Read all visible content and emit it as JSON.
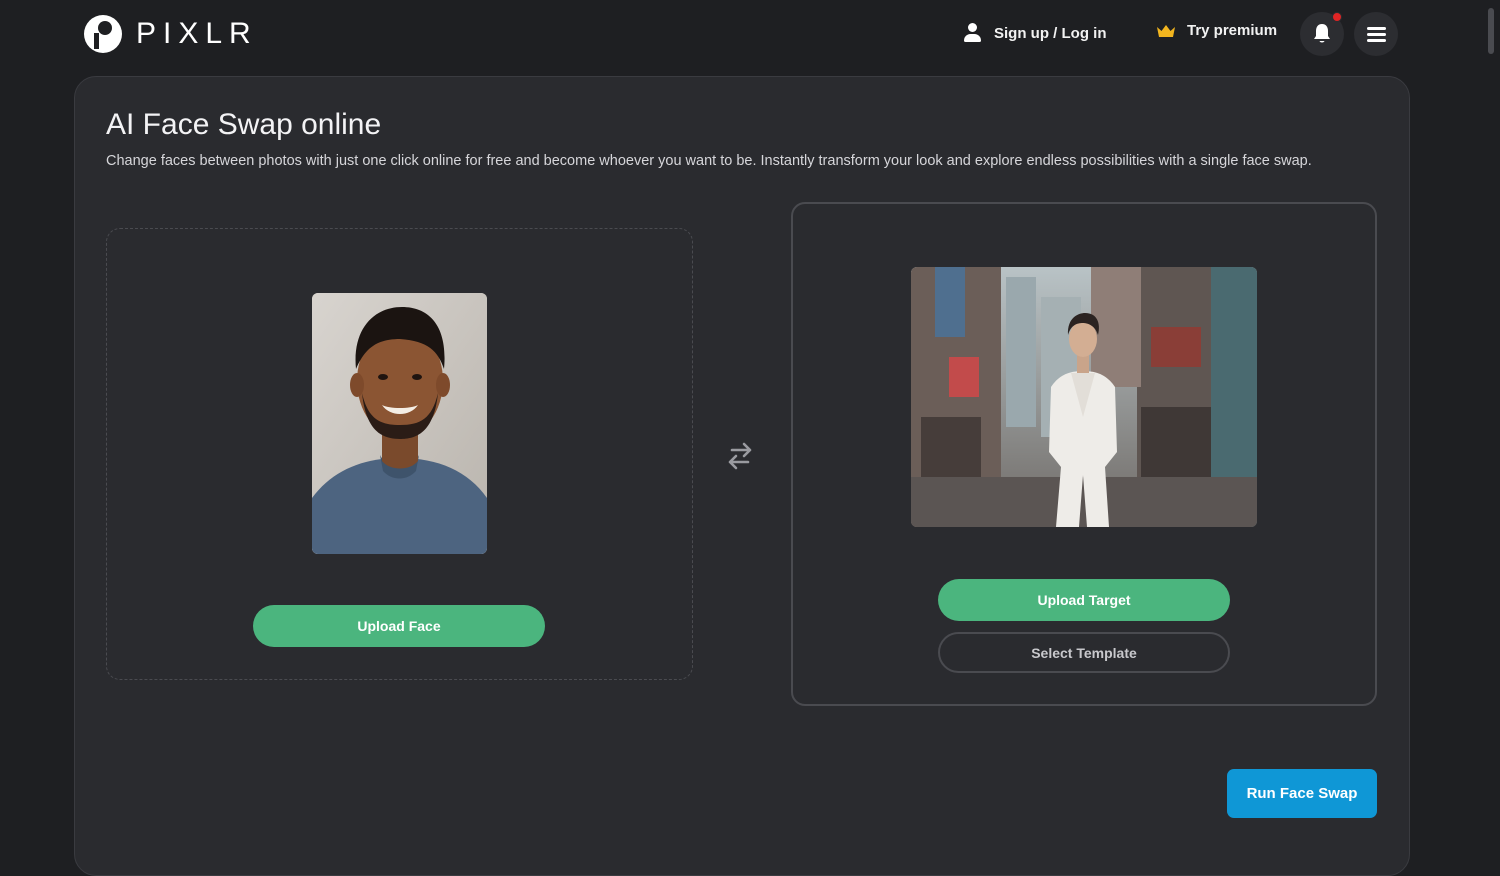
{
  "header": {
    "logo_text": "PIXLR",
    "signin_label": "Sign up / Log in",
    "premium_label": "Try premium",
    "has_notification": true
  },
  "main": {
    "title": "AI Face Swap online",
    "description": "Change faces between photos with just one click online for free and become whoever you want to be. Instantly transform your look and explore endless possibilities with a single face swap.",
    "face_panel": {
      "upload_label": "Upload Face"
    },
    "target_panel": {
      "upload_label": "Upload Target",
      "template_label": "Select Template"
    },
    "run_label": "Run Face Swap"
  },
  "colors": {
    "background": "#1e1f22",
    "panel": "#2a2b2f",
    "accent_green": "#4bb57e",
    "accent_blue": "#0f97d6",
    "notification": "#e02424",
    "crown": "#f2b51f"
  },
  "icons": [
    "pixlr-logo-icon",
    "user-icon",
    "crown-icon",
    "bell-icon",
    "menu-icon",
    "swap-arrows-icon"
  ]
}
